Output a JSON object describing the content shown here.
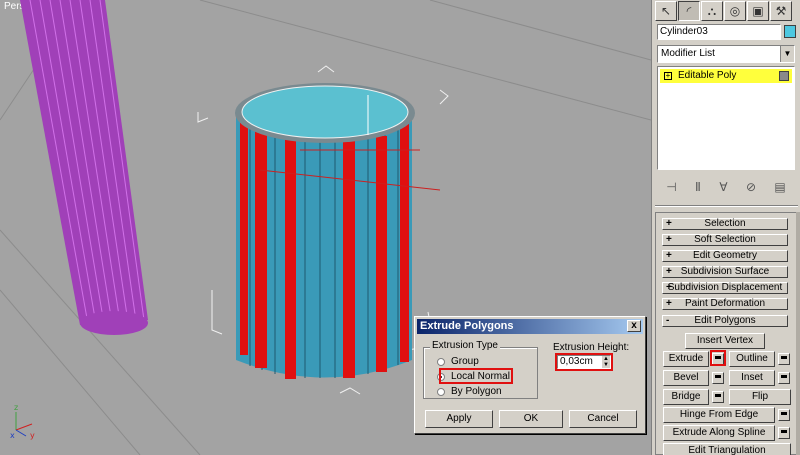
{
  "viewport": {
    "label": "Perspective",
    "colors": {
      "background": "#a3a3a3",
      "cylinder_top": "#5bc0d0",
      "cylinder_side": "#3a9ab8",
      "extruded_faces": "#e01010",
      "pillar": "#b040c0"
    }
  },
  "dialog": {
    "title": "Extrude Polygons",
    "close": "x",
    "extrusion_type_label": "Extrusion Type",
    "options": [
      {
        "label": "Group",
        "selected": false
      },
      {
        "label": "Local Normal",
        "selected": true
      },
      {
        "label": "By Polygon",
        "selected": false
      }
    ],
    "height_label": "Extrusion Height:",
    "height_value": "0,03cm",
    "apply": "Apply",
    "ok": "OK",
    "cancel": "Cancel"
  },
  "panel": {
    "tabs": [
      "create-icon",
      "modify-icon",
      "hierarchy-icon",
      "motion-icon",
      "display-icon",
      "utilities-icon"
    ],
    "object_name": "Cylinder03",
    "object_color": "#4ec8e0",
    "modifier_list": "Modifier List",
    "stack": {
      "item": "Editable Poly",
      "highlight": "#ffff3c"
    },
    "rollouts": [
      {
        "sign": "+",
        "label": "Selection"
      },
      {
        "sign": "+",
        "label": "Soft Selection"
      },
      {
        "sign": "+",
        "label": "Edit Geometry"
      },
      {
        "sign": "+",
        "label": "Subdivision Surface"
      },
      {
        "sign": "+",
        "label": "Subdivision Displacement"
      },
      {
        "sign": "+",
        "label": "Paint Deformation"
      },
      {
        "sign": "-",
        "label": "Edit Polygons"
      }
    ],
    "edit_polygons": {
      "insert_vertex": "Insert Vertex",
      "extrude": "Extrude",
      "outline": "Outline",
      "bevel": "Bevel",
      "inset": "Inset",
      "bridge": "Bridge",
      "flip": "Flip",
      "hinge": "Hinge From Edge",
      "extrude_spline": "Extrude Along Spline",
      "edit_triangulation": "Edit Triangulation"
    }
  }
}
